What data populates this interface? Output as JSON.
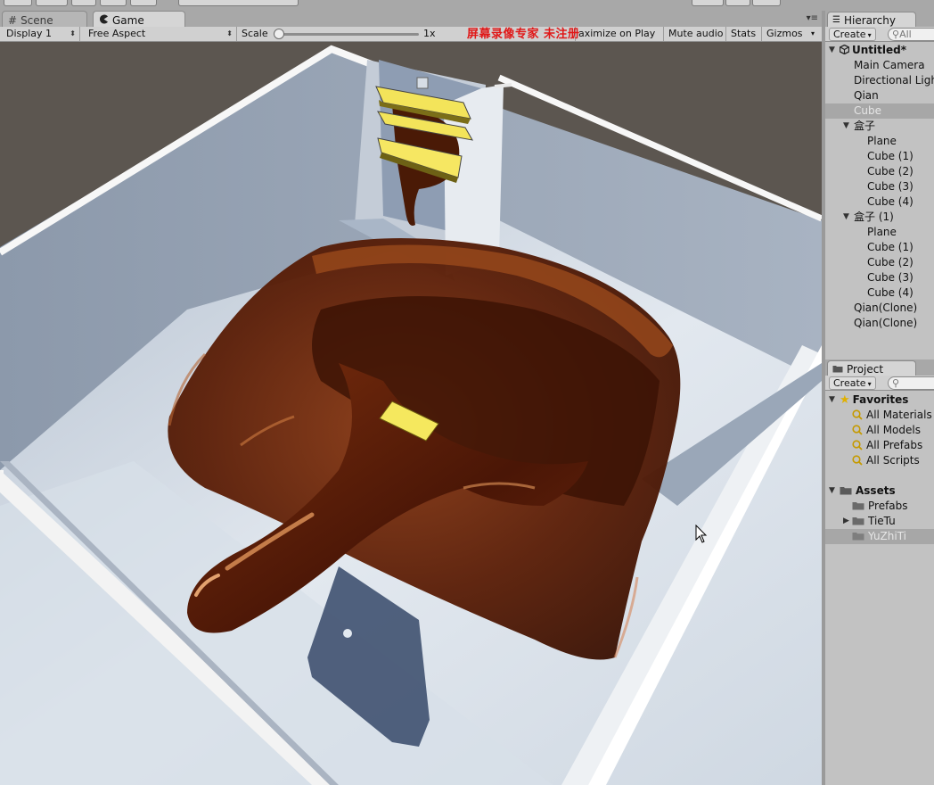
{
  "game_view": {
    "tabs": [
      {
        "label": "Scene",
        "icon": "scene-grid-icon",
        "active": false
      },
      {
        "label": "Game",
        "icon": "game-pacman-icon",
        "active": true
      }
    ],
    "toolbar": {
      "display": "Display 1",
      "aspect": "Free Aspect",
      "scale_label": "Scale",
      "scale_value": "1x",
      "maximize_on_play": "aximize on Play",
      "mute_audio": "Mute audio",
      "stats": "Stats",
      "gizmos": "Gizmos"
    },
    "watermark": "屏幕录像专家 未注册"
  },
  "hierarchy": {
    "tab": "Hierarchy",
    "create": "Create",
    "search_placeholder": "All",
    "scene_name": "Untitled*",
    "items": [
      {
        "label": "Main Camera"
      },
      {
        "label": "Directional Light"
      },
      {
        "label": "Qian"
      },
      {
        "label": "Cube",
        "selected": true
      },
      {
        "label": "盒子"
      },
      {
        "label": "Plane"
      },
      {
        "label": "Cube (1)"
      },
      {
        "label": "Cube (2)"
      },
      {
        "label": "Cube (3)"
      },
      {
        "label": "Cube (4)"
      },
      {
        "label": "盒子 (1)"
      },
      {
        "label": "Plane"
      },
      {
        "label": "Cube (1)"
      },
      {
        "label": "Cube (2)"
      },
      {
        "label": "Cube (3)"
      },
      {
        "label": "Cube (4)"
      },
      {
        "label": "Qian(Clone)"
      },
      {
        "label": "Qian(Clone)"
      }
    ]
  },
  "project": {
    "tab": "Project",
    "create": "Create",
    "favorites": {
      "label": "Favorites",
      "items": [
        "All Materials",
        "All Models",
        "All Prefabs",
        "All Scripts"
      ]
    },
    "assets": {
      "label": "Assets",
      "items": [
        {
          "label": "Prefabs"
        },
        {
          "label": "TieTu"
        },
        {
          "label": "YuZhiTi",
          "selected": true
        }
      ]
    }
  },
  "colors": {
    "chocolate": "#5a1e08",
    "chocolate_highlight": "#c8703a",
    "floor": "#dfe6ee",
    "wall": "#94a0b0",
    "platform": "#f0e050",
    "background": "#5c5650",
    "selection": "#a7a7a7"
  }
}
